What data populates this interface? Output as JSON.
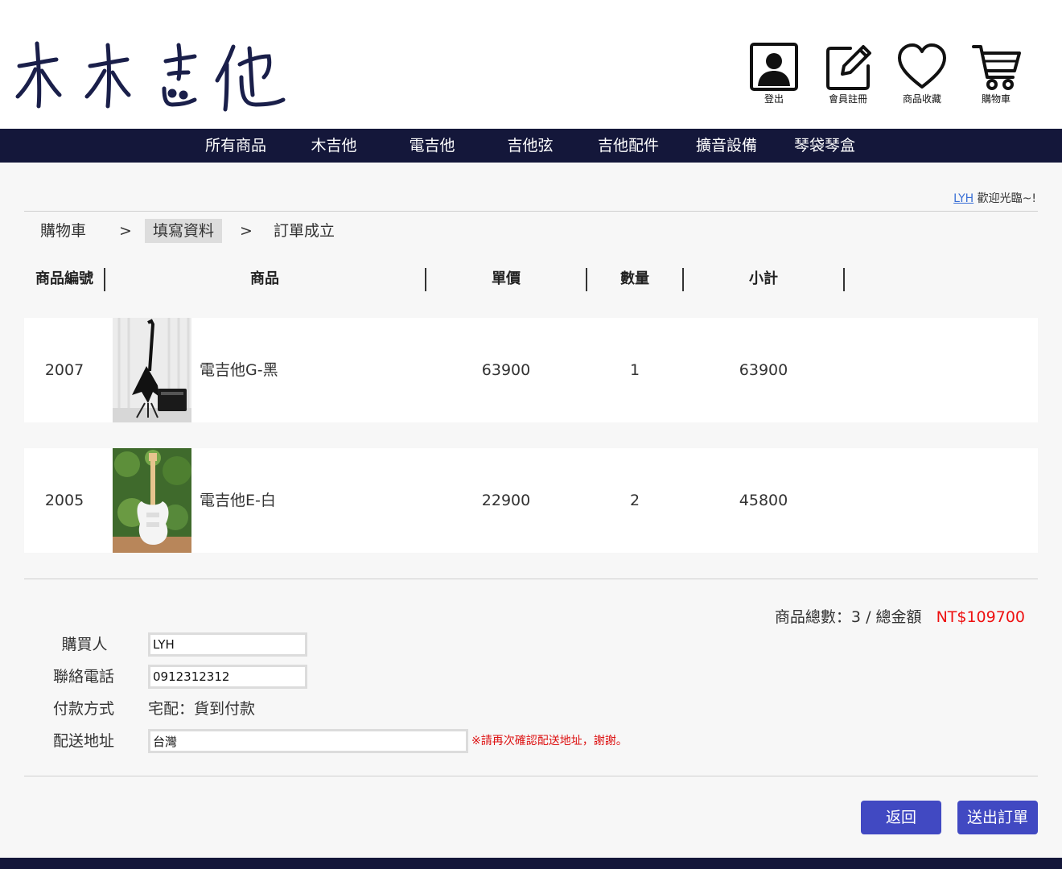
{
  "header": {
    "logo_text": "木木吉他",
    "icons": [
      {
        "name": "logout",
        "icon": "user-avatar-icon",
        "label": "登出"
      },
      {
        "name": "register",
        "icon": "edit-icon",
        "label": "會員註冊"
      },
      {
        "name": "favorites",
        "icon": "heart-icon",
        "label": "商品收藏"
      },
      {
        "name": "cart",
        "icon": "cart-icon",
        "label": "購物車"
      }
    ]
  },
  "nav": {
    "items": [
      "所有商品",
      "木吉他",
      "電吉他",
      "吉他弦",
      "吉他配件",
      "擴音設備",
      "琴袋琴盒"
    ],
    "bg_color": "#14173a"
  },
  "welcome": {
    "user": "LYH",
    "text": "歡迎光臨~!"
  },
  "breadcrumb": {
    "steps": [
      "購物車",
      "填寫資料",
      "訂單成立"
    ],
    "separator": ">",
    "active_index": 1
  },
  "table": {
    "headers": [
      "商品編號",
      "商品",
      "單價",
      "數量",
      "小計"
    ],
    "rows": [
      {
        "id": "2007",
        "image": "black-electric-guitar-photo",
        "name": "電吉他G-黑",
        "price": "63900",
        "qty": "1",
        "subtotal": "63900"
      },
      {
        "id": "2005",
        "image": "white-electric-guitar-photo",
        "name": "電吉他E-白",
        "price": "22900",
        "qty": "2",
        "subtotal": "45800"
      }
    ]
  },
  "totals": {
    "count_label": "商品總數：3",
    "amount_label": "/ 總金額",
    "amount": "NT$109700",
    "amount_color": "#e11111"
  },
  "form": {
    "buyer_label": "購買人",
    "buyer_value": "LYH",
    "phone_label": "聯絡電話",
    "phone_value": "0912312312",
    "payment_label": "付款方式",
    "payment_value": "宅配：貨到付款",
    "address_label": "配送地址",
    "address_value": "台灣",
    "address_warning": "※請再次確認配送地址，謝謝。"
  },
  "actions": {
    "back_label": "返回",
    "submit_label": "送出訂單",
    "button_color": "#4149c2"
  }
}
